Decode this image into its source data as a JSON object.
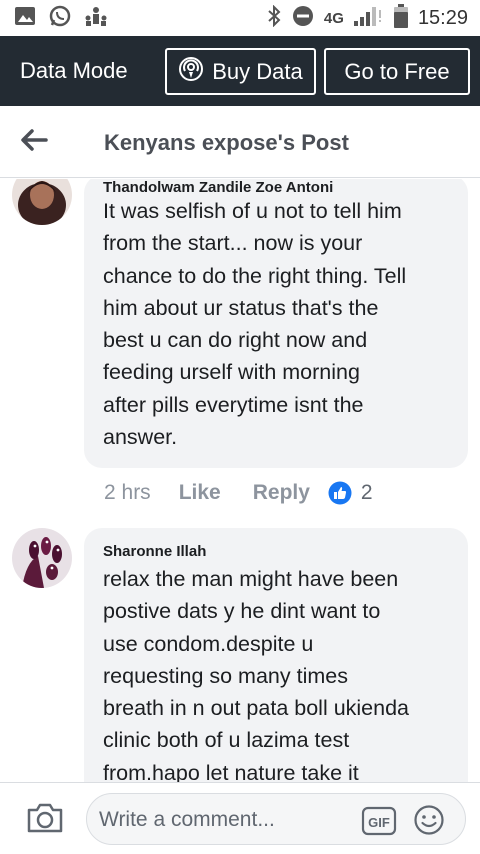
{
  "status_bar": {
    "network": "4G",
    "time": "15:29",
    "left_icons": [
      "image-icon",
      "whatsapp-icon",
      "people-icon"
    ],
    "right_icons": [
      "bluetooth-icon",
      "do-not-disturb-icon",
      "signal-icon",
      "battery-icon"
    ]
  },
  "data_bar": {
    "mode_label": "Data Mode",
    "buy_label": "Buy Data",
    "free_label": "Go to Free"
  },
  "header": {
    "title": "Kenyans expose's Post"
  },
  "comments": [
    {
      "author": "Thandolwam Zandile Zoe Antoni",
      "text": "It was selfish of u not to tell him\nfrom the start... now is your\nchance to do the right thing. Tell\nhim about ur status that's the\nbest u can do right now and\nfeeding urself with morning\nafter pills everytime isnt the\nanswer.",
      "time": "2 hrs",
      "like_label": "Like",
      "reply_label": "Reply",
      "reaction_count": "2"
    },
    {
      "author": "Sharonne Illah",
      "text": "relax the man might have been\npostive dats y he dint want to\nuse condom.despite u\nrequesting so many times\nbreath in n out pata boll ukienda\nclinic both of u lazima test\nfrom.hapo let nature take it"
    }
  ],
  "composer": {
    "placeholder": "Write a comment..."
  }
}
